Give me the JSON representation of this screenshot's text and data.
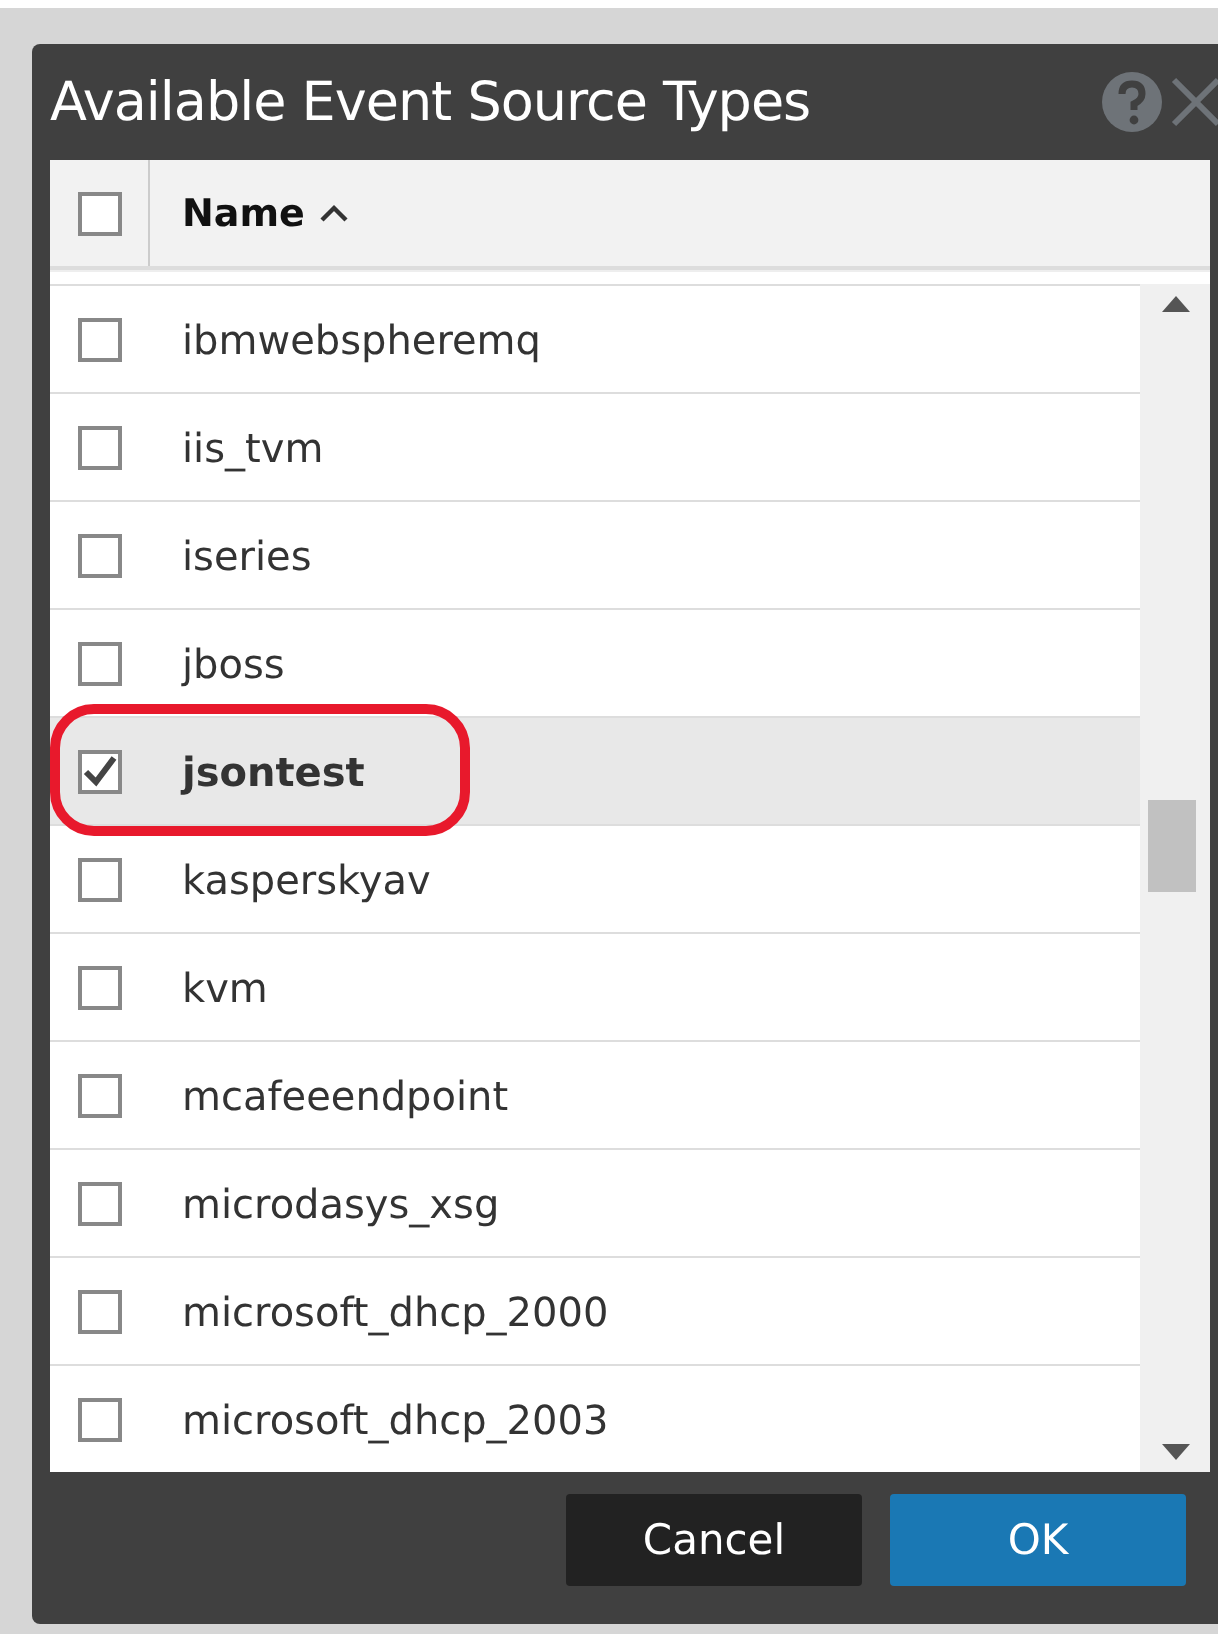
{
  "dialog": {
    "title": "Available Event Source Types"
  },
  "table": {
    "select_all": {
      "checked": false
    },
    "columns": [
      {
        "label": "Name",
        "sorted_ascending": true
      }
    ],
    "rows": [
      {
        "name": "ibmwebspheremq",
        "checked": false,
        "circled": false
      },
      {
        "name": "iis_tvm",
        "checked": false,
        "circled": false
      },
      {
        "name": "iseries",
        "checked": false,
        "circled": false
      },
      {
        "name": "jboss",
        "checked": false,
        "circled": false
      },
      {
        "name": "jsontest",
        "checked": true,
        "circled": true
      },
      {
        "name": "kasperskyav",
        "checked": false,
        "circled": false
      },
      {
        "name": "kvm",
        "checked": false,
        "circled": false
      },
      {
        "name": "mcafeeendpoint",
        "checked": false,
        "circled": false
      },
      {
        "name": "microdasys_xsg",
        "checked": false,
        "circled": false
      },
      {
        "name": "microsoft_dhcp_2000",
        "checked": false,
        "circled": false
      },
      {
        "name": "microsoft_dhcp_2003",
        "checked": false,
        "circled": false
      }
    ]
  },
  "buttons": [
    {
      "label": "Cancel",
      "kind": "secondary"
    },
    {
      "label": "OK",
      "kind": "primary"
    }
  ]
}
